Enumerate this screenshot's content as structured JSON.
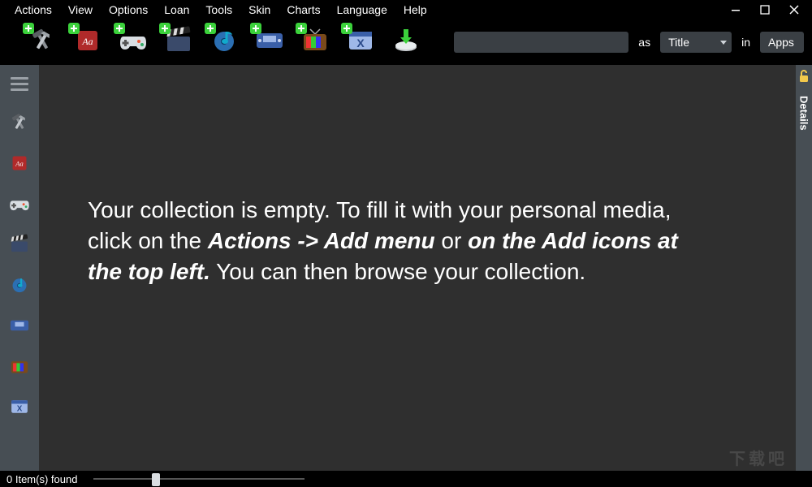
{
  "menu": {
    "items": [
      {
        "label": "Actions"
      },
      {
        "label": "View"
      },
      {
        "label": "Options"
      },
      {
        "label": "Loan"
      },
      {
        "label": "Tools"
      },
      {
        "label": "Skin"
      },
      {
        "label": "Charts"
      },
      {
        "label": "Language"
      },
      {
        "label": "Help"
      }
    ]
  },
  "toolbar": {
    "add_icons": [
      {
        "name": "tools",
        "icon": "hammer-wrench-icon"
      },
      {
        "name": "books",
        "icon": "book-icon"
      },
      {
        "name": "games",
        "icon": "gamepad-icon"
      },
      {
        "name": "movies",
        "icon": "clapperboard-icon"
      },
      {
        "name": "music",
        "icon": "music-note-icon"
      },
      {
        "name": "handheld",
        "icon": "handheld-icon"
      },
      {
        "name": "tv",
        "icon": "tv-icon"
      },
      {
        "name": "xapp",
        "icon": "x-app-icon"
      },
      {
        "name": "import",
        "icon": "download-disk-icon"
      }
    ],
    "search_value": "",
    "search_placeholder": "",
    "label_as": "as",
    "dd_title_label": "Title",
    "label_in": "in",
    "dd_apps_label": "Apps"
  },
  "left_rail": {
    "items": [
      {
        "icon": "menu-icon"
      },
      {
        "icon": "hammer-wrench-icon"
      },
      {
        "icon": "book-icon"
      },
      {
        "icon": "gamepad-icon"
      },
      {
        "icon": "clapperboard-icon"
      },
      {
        "icon": "music-note-icon"
      },
      {
        "icon": "handheld-icon"
      },
      {
        "icon": "tv-icon"
      },
      {
        "icon": "x-app-icon"
      }
    ]
  },
  "right_rail": {
    "details_label": "Details"
  },
  "content": {
    "empty": {
      "p1a": "Your collection is empty. To fill it with your personal media, click on the ",
      "p1b": "Actions -> Add menu",
      "p1c": " or ",
      "p1d": "on the Add icons at the top left.",
      "p1e": " You can then browse your collection."
    }
  },
  "status": {
    "found_label": "0 Item(s) found"
  },
  "watermark": "下载吧"
}
